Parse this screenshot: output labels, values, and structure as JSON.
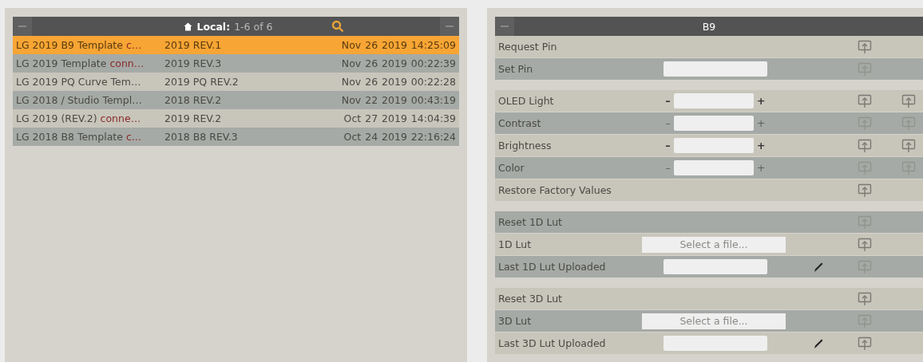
{
  "library": {
    "header": {
      "label": "Local:",
      "count": "1-6 of 6"
    },
    "rows": [
      {
        "name": "LG 2019 B9 Template ",
        "tag": "c…",
        "revision": "2019 REV.1",
        "date": "Nov  26  2019  14:25:09",
        "selected": true
      },
      {
        "name": "LG 2019 Template ",
        "tag": "conn…",
        "revision": "2019 REV.3",
        "date": "Nov  26  2019  00:22:39",
        "selected": false
      },
      {
        "name": "LG 2019 PQ Curve Tem…",
        "revision": "2019 PQ REV.2",
        "date": "Nov  26  2019  00:22:28",
        "selected": false
      },
      {
        "name": "LG 2018 / Studio Templ…",
        "revision": "2018 REV.2",
        "date": "Nov  22  2019  00:43:19",
        "selected": false
      },
      {
        "name": "LG 2019 (REV.2) ",
        "tag": "conne…",
        "revision": "2019 REV.2",
        "date": "Oct  27  2019  14:04:39",
        "selected": false
      },
      {
        "name": "LG 2018 B8 Template ",
        "tag": "c…",
        "revision": "2018 B8 REV.3",
        "date": "Oct  24  2019  22:16:24",
        "selected": false
      }
    ]
  },
  "device": {
    "title": "B9",
    "sections": [
      {
        "rows": [
          {
            "kind": "action",
            "label": "Request Pin",
            "disabled": false
          },
          {
            "kind": "text",
            "label": "Set Pin",
            "disabled": true
          }
        ]
      },
      {
        "rows": [
          {
            "kind": "spinner",
            "label": "OLED Light",
            "minus": "–",
            "plus": "+",
            "disabled": false
          },
          {
            "kind": "spinner",
            "label": "Contrast",
            "minus": "–",
            "plus": "+",
            "disabled": true
          },
          {
            "kind": "spinner",
            "label": "Brightness",
            "minus": "–",
            "plus": "+",
            "disabled": false
          },
          {
            "kind": "spinner",
            "label": "Color",
            "minus": "–",
            "plus": "+",
            "disabled": true
          },
          {
            "kind": "action",
            "label": "Restore Factory Values",
            "disabled": false
          }
        ]
      },
      {
        "rows": [
          {
            "kind": "action",
            "label": "Reset 1D Lut",
            "disabled": true
          },
          {
            "kind": "file",
            "label": "1D Lut",
            "button": "Select a file...",
            "disabled": false
          },
          {
            "kind": "uploaded",
            "label": "Last 1D Lut Uploaded",
            "disabled": true
          }
        ]
      },
      {
        "rows": [
          {
            "kind": "action",
            "label": "Reset 3D Lut",
            "disabled": false
          },
          {
            "kind": "file",
            "label": "3D Lut",
            "button": "Select a file...",
            "disabled": true
          },
          {
            "kind": "uploaded",
            "label": "Last 3D Lut Uploaded",
            "disabled": false
          }
        ]
      }
    ]
  }
}
